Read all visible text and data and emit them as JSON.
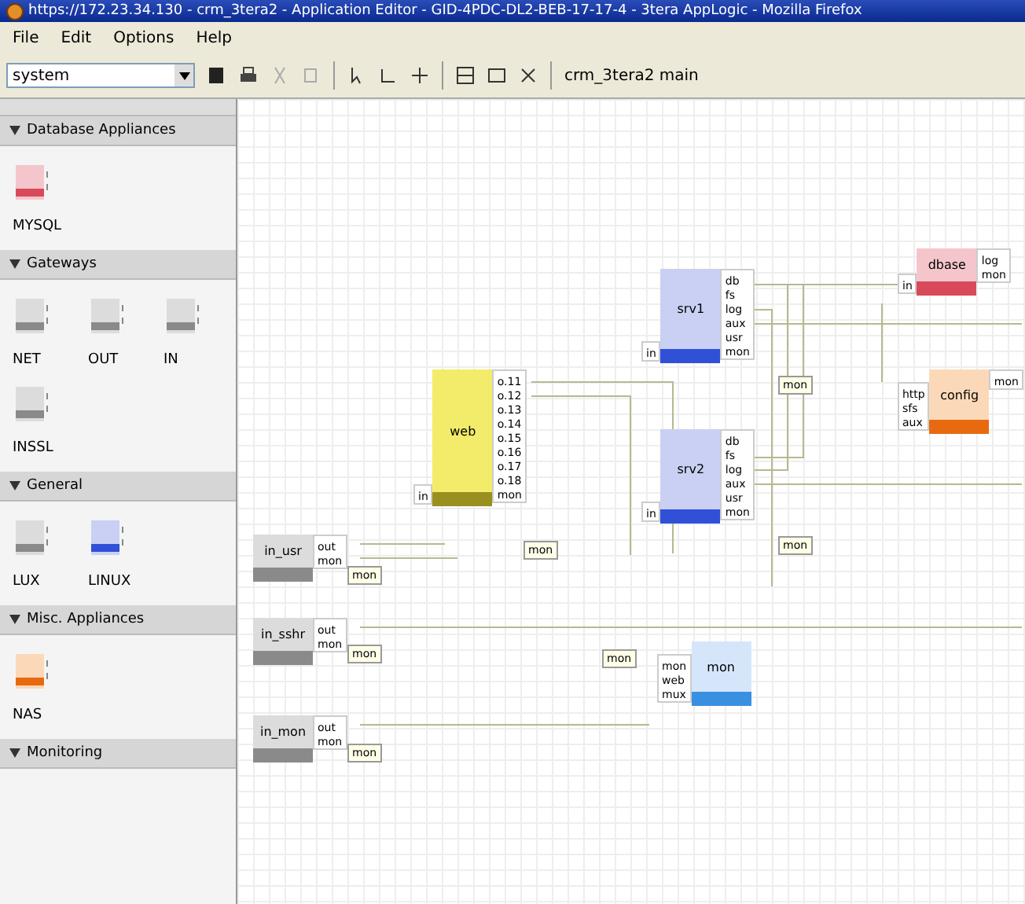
{
  "window": {
    "title": "https://172.23.34.130 - crm_3tera2 - Application Editor - GID-4PDC-DL2-BEB-17-17-4 - 3tera AppLogic - Mozilla Firefox"
  },
  "menu": [
    "File",
    "Edit",
    "Options",
    "Help"
  ],
  "toolbar": {
    "catalog": "system",
    "breadcrumb": "crm_3tera2  main"
  },
  "sidebar": {
    "sections": [
      {
        "title": "Database Appliances",
        "expanded": true,
        "items": [
          {
            "label": "MYSQL",
            "kind": "pink"
          }
        ]
      },
      {
        "title": "Gateways",
        "expanded": true,
        "items": [
          {
            "label": "NET",
            "kind": "gray"
          },
          {
            "label": "OUT",
            "kind": "gray"
          },
          {
            "label": "IN",
            "kind": "gray"
          },
          {
            "label": "INSSL",
            "kind": "gray"
          }
        ]
      },
      {
        "title": "General",
        "expanded": true,
        "items": [
          {
            "label": "LUX",
            "kind": "gray"
          },
          {
            "label": "LINUX",
            "kind": "blue"
          }
        ]
      },
      {
        "title": "Misc. Appliances",
        "expanded": true,
        "items": [
          {
            "label": "NAS",
            "kind": "orange"
          }
        ]
      },
      {
        "title": "Monitoring",
        "expanded": true
      }
    ]
  },
  "canvas": {
    "nodes": [
      {
        "label": "in_usr",
        "kind": "gray",
        "outputs": [
          "out",
          "mon"
        ]
      },
      {
        "label": "in_sshr",
        "kind": "gray",
        "outputs": [
          "out",
          "mon"
        ]
      },
      {
        "label": "in_mon",
        "kind": "gray",
        "outputs": [
          "out",
          "mon"
        ]
      },
      {
        "label": "web",
        "kind": "yellow",
        "inputs": [
          "in"
        ],
        "outputs": [
          "o.11",
          "o.12",
          "o.13",
          "o.14",
          "o.15",
          "o.16",
          "o.17",
          "o.18",
          "mon"
        ]
      },
      {
        "label": "srv1",
        "kind": "blue",
        "inputs": [
          "in"
        ],
        "outputs": [
          "db",
          "fs",
          "log",
          "aux",
          "usr",
          "mon"
        ]
      },
      {
        "label": "srv2",
        "kind": "blue",
        "inputs": [
          "in"
        ],
        "outputs": [
          "db",
          "fs",
          "log",
          "aux",
          "usr",
          "mon"
        ]
      },
      {
        "label": "dbase",
        "kind": "pink",
        "inputs": [
          "in"
        ],
        "outputs": [
          "log",
          "mon"
        ]
      },
      {
        "label": "config",
        "kind": "orange",
        "inputs": [
          "http",
          "sfs",
          "aux"
        ],
        "outputs": [
          "mon"
        ]
      },
      {
        "label": "mon",
        "kind": "lightblue",
        "inputs": [
          "mon",
          "web",
          "mux"
        ]
      }
    ],
    "terminals": [
      "mon",
      "mon",
      "mon",
      "mon",
      "mon",
      "mon",
      "mon"
    ]
  }
}
